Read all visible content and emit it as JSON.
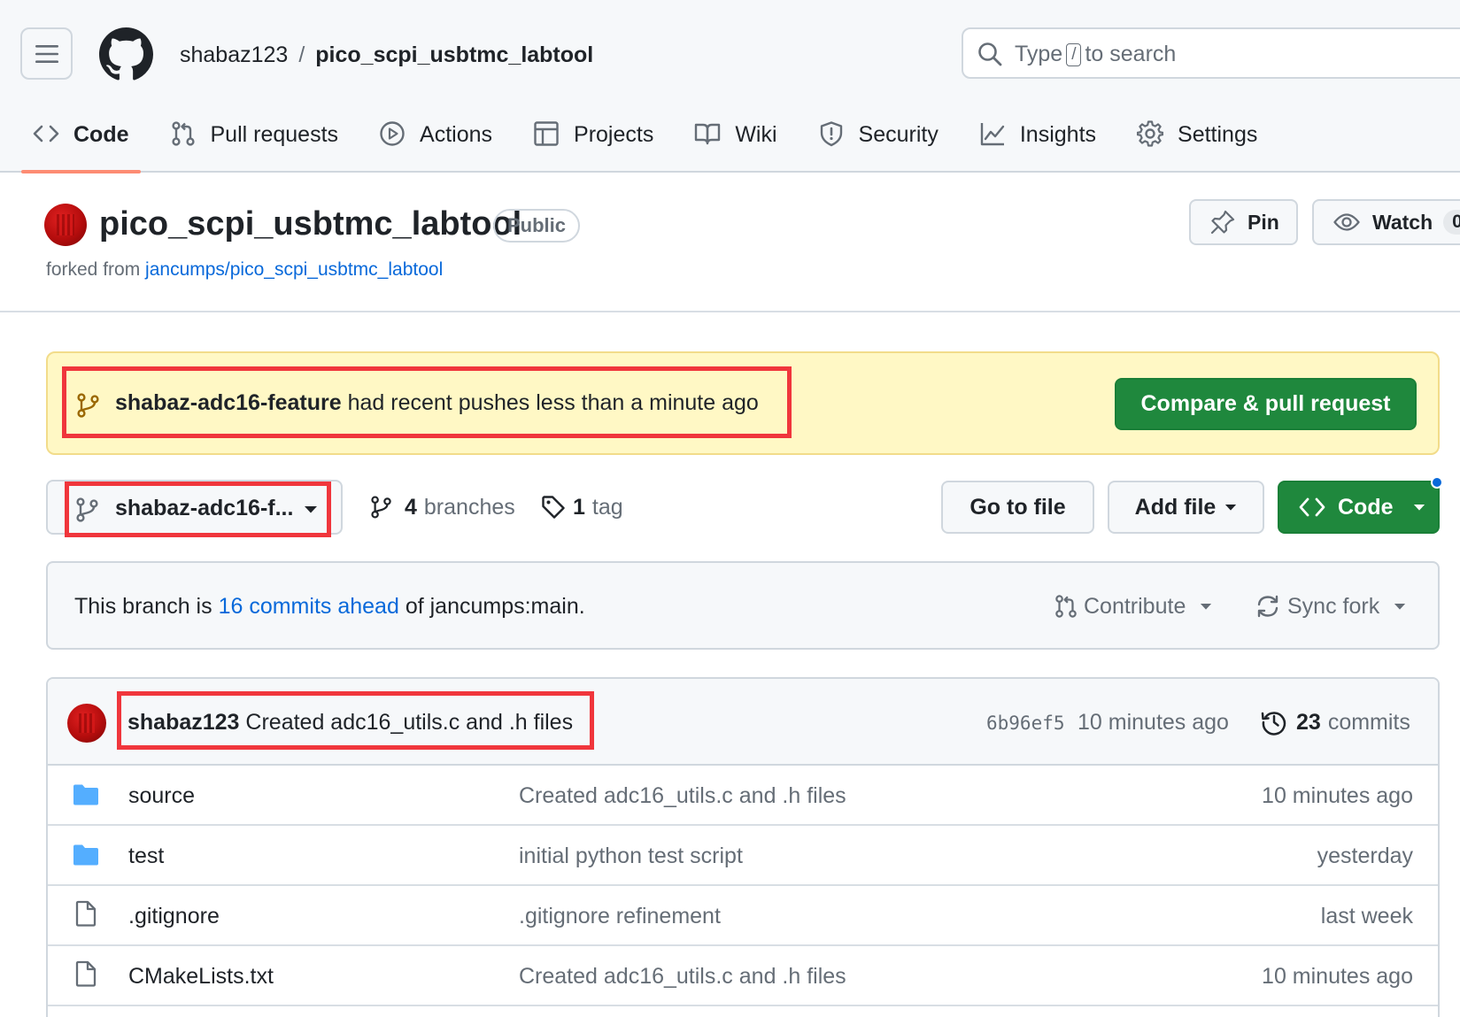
{
  "header": {
    "owner": "shabaz123",
    "separator": "/",
    "repo": "pico_scpi_usbtmc_labtool",
    "search": {
      "prefix": "Type",
      "key": "/",
      "suffix": "to search"
    }
  },
  "tabs": [
    {
      "label": "Code",
      "icon": "code-icon",
      "active": true
    },
    {
      "label": "Pull requests",
      "icon": "git-pull-request-icon"
    },
    {
      "label": "Actions",
      "icon": "play-icon"
    },
    {
      "label": "Projects",
      "icon": "table-icon"
    },
    {
      "label": "Wiki",
      "icon": "book-icon"
    },
    {
      "label": "Security",
      "icon": "shield-icon"
    },
    {
      "label": "Insights",
      "icon": "graph-icon"
    },
    {
      "label": "Settings",
      "icon": "gear-icon"
    }
  ],
  "repo": {
    "name": "pico_scpi_usbtmc_labtool",
    "visibility": "Public",
    "forked_prefix": "forked from",
    "forked_from": "jancumps/pico_scpi_usbtmc_labtool",
    "pin_label": "Pin",
    "watch_label": "Watch",
    "watch_count": "0"
  },
  "banner": {
    "branch": "shabaz-adc16-feature",
    "message": "had recent pushes less than a minute ago",
    "button": "Compare & pull request"
  },
  "branch_bar": {
    "current_branch": "shabaz-adc16-f...",
    "branches_count": "4",
    "branches_label": "branches",
    "tags_count": "1",
    "tags_label": "tag",
    "go_to_file": "Go to file",
    "add_file": "Add file",
    "code": "Code"
  },
  "ahead": {
    "prefix": "This branch is",
    "link": "16 commits ahead",
    "suffix": "of jancumps:main.",
    "contribute": "Contribute",
    "sync_fork": "Sync fork"
  },
  "latest_commit": {
    "author": "shabaz123",
    "message": "Created adc16_utils.c and .h files",
    "sha": "6b96ef5",
    "time": "10 minutes ago",
    "commits_count": "23",
    "commits_label": "commits"
  },
  "files": [
    {
      "type": "folder",
      "name": "source",
      "message": "Created adc16_utils.c and .h files",
      "time": "10 minutes ago"
    },
    {
      "type": "folder",
      "name": "test",
      "message": "initial python test script",
      "time": "yesterday"
    },
    {
      "type": "file",
      "name": ".gitignore",
      "message": ".gitignore refinement",
      "time": "last week"
    },
    {
      "type": "file",
      "name": "CMakeLists.txt",
      "message": "Created adc16_utils.c and .h files",
      "time": "10 minutes ago"
    }
  ],
  "colors": {
    "accent_green": "#1f883d",
    "link_blue": "#0969da",
    "banner_bg": "#fff8c5",
    "highlight_red": "#f0363c",
    "tab_underline": "#fd8c73"
  }
}
